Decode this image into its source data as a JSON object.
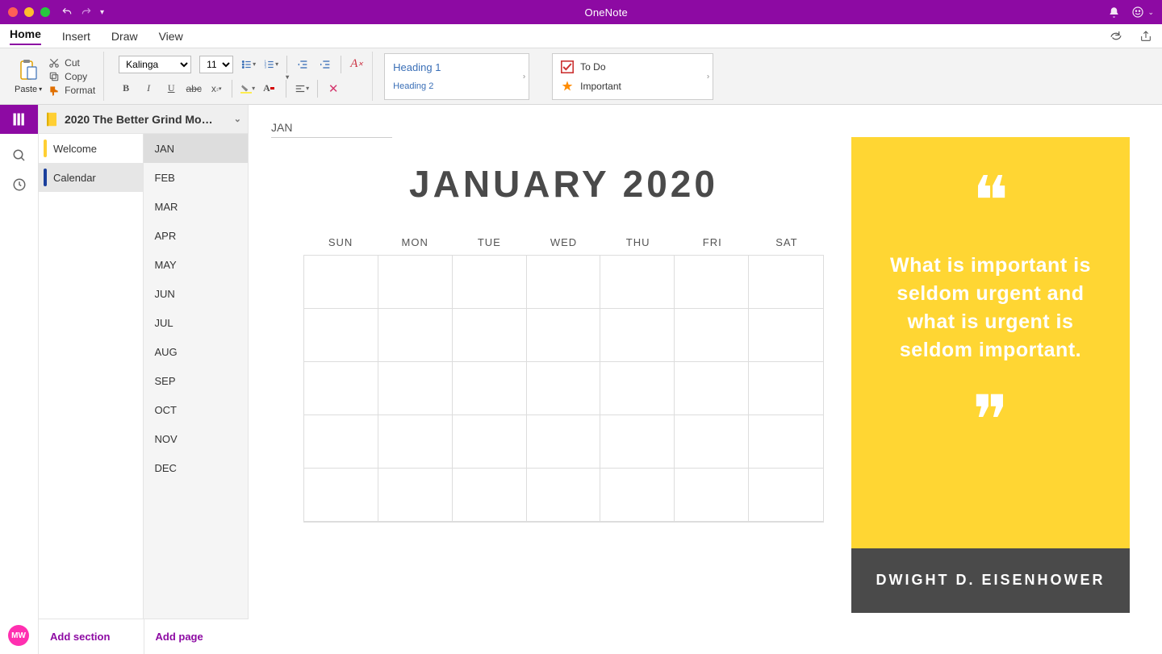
{
  "titlebar": {
    "app_name": "OneNote"
  },
  "menu": {
    "tabs": [
      "Home",
      "Insert",
      "Draw",
      "View"
    ],
    "active": 0
  },
  "ribbon": {
    "paste_label": "Paste",
    "cut_label": "Cut",
    "copy_label": "Copy",
    "format_label": "Format",
    "font_name": "Kalinga",
    "font_size": "11",
    "heading1": "Heading 1",
    "heading2": "Heading 2",
    "todo_label": "To Do",
    "important_label": "Important"
  },
  "notebook": {
    "title": "2020 The Better Grind Mo…",
    "sections": [
      {
        "name": "Welcome",
        "color": "#ffcf33",
        "active": false
      },
      {
        "name": "Calendar",
        "color": "#1a3f9c",
        "active": true
      }
    ],
    "pages": [
      "JAN",
      "FEB",
      "MAR",
      "APR",
      "MAY",
      "JUN",
      "JUL",
      "AUG",
      "SEP",
      "OCT",
      "NOV",
      "DEC"
    ],
    "active_page_index": 0,
    "add_section": "Add section",
    "add_page": "Add page"
  },
  "avatar": "MW",
  "page": {
    "title": "JAN",
    "calendar_title": "JANUARY 2020",
    "days": [
      "SUN",
      "MON",
      "TUE",
      "WED",
      "THU",
      "FRI",
      "SAT"
    ]
  },
  "quote": {
    "text": "What is important is seldom urgent and what is urgent is seldom important.",
    "author": "DWIGHT D. EISENHOWER"
  }
}
